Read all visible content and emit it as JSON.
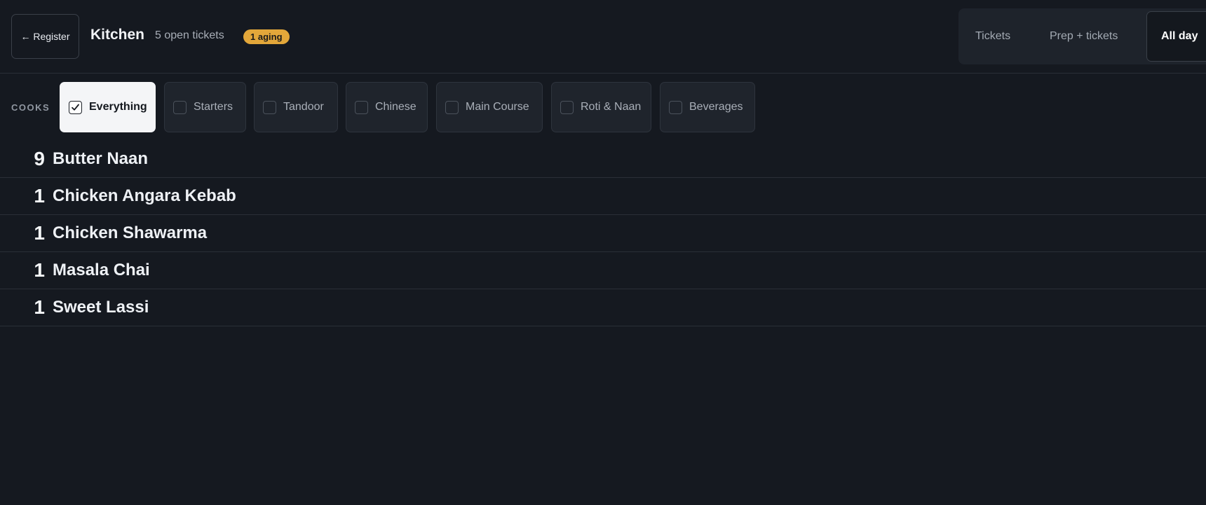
{
  "header": {
    "register_label": "← Register",
    "title": "Kitchen",
    "open_tickets": "5 open tickets",
    "aging_badge": "1 aging",
    "view_tabs": [
      {
        "label": "Tickets",
        "active": false
      },
      {
        "label": "Prep + tickets",
        "active": false
      },
      {
        "label": "All day",
        "active": true
      }
    ]
  },
  "filters": {
    "label": "COOKS",
    "chips": [
      {
        "label": "Everything",
        "checked": true
      },
      {
        "label": "Starters",
        "checked": false
      },
      {
        "label": "Tandoor",
        "checked": false
      },
      {
        "label": "Chinese",
        "checked": false
      },
      {
        "label": "Main Course",
        "checked": false
      },
      {
        "label": "Roti & Naan",
        "checked": false
      },
      {
        "label": "Beverages",
        "checked": false
      }
    ]
  },
  "items": [
    {
      "qty": "9",
      "name": "Butter Naan"
    },
    {
      "qty": "1",
      "name": "Chicken Angara Kebab"
    },
    {
      "qty": "1",
      "name": "Chicken Shawarma"
    },
    {
      "qty": "1",
      "name": "Masala Chai"
    },
    {
      "qty": "1",
      "name": "Sweet Lassi"
    }
  ],
  "colors": {
    "background": "#151920",
    "aging_badge": "#e3a73a",
    "active_chip": "#f4f5f7"
  }
}
